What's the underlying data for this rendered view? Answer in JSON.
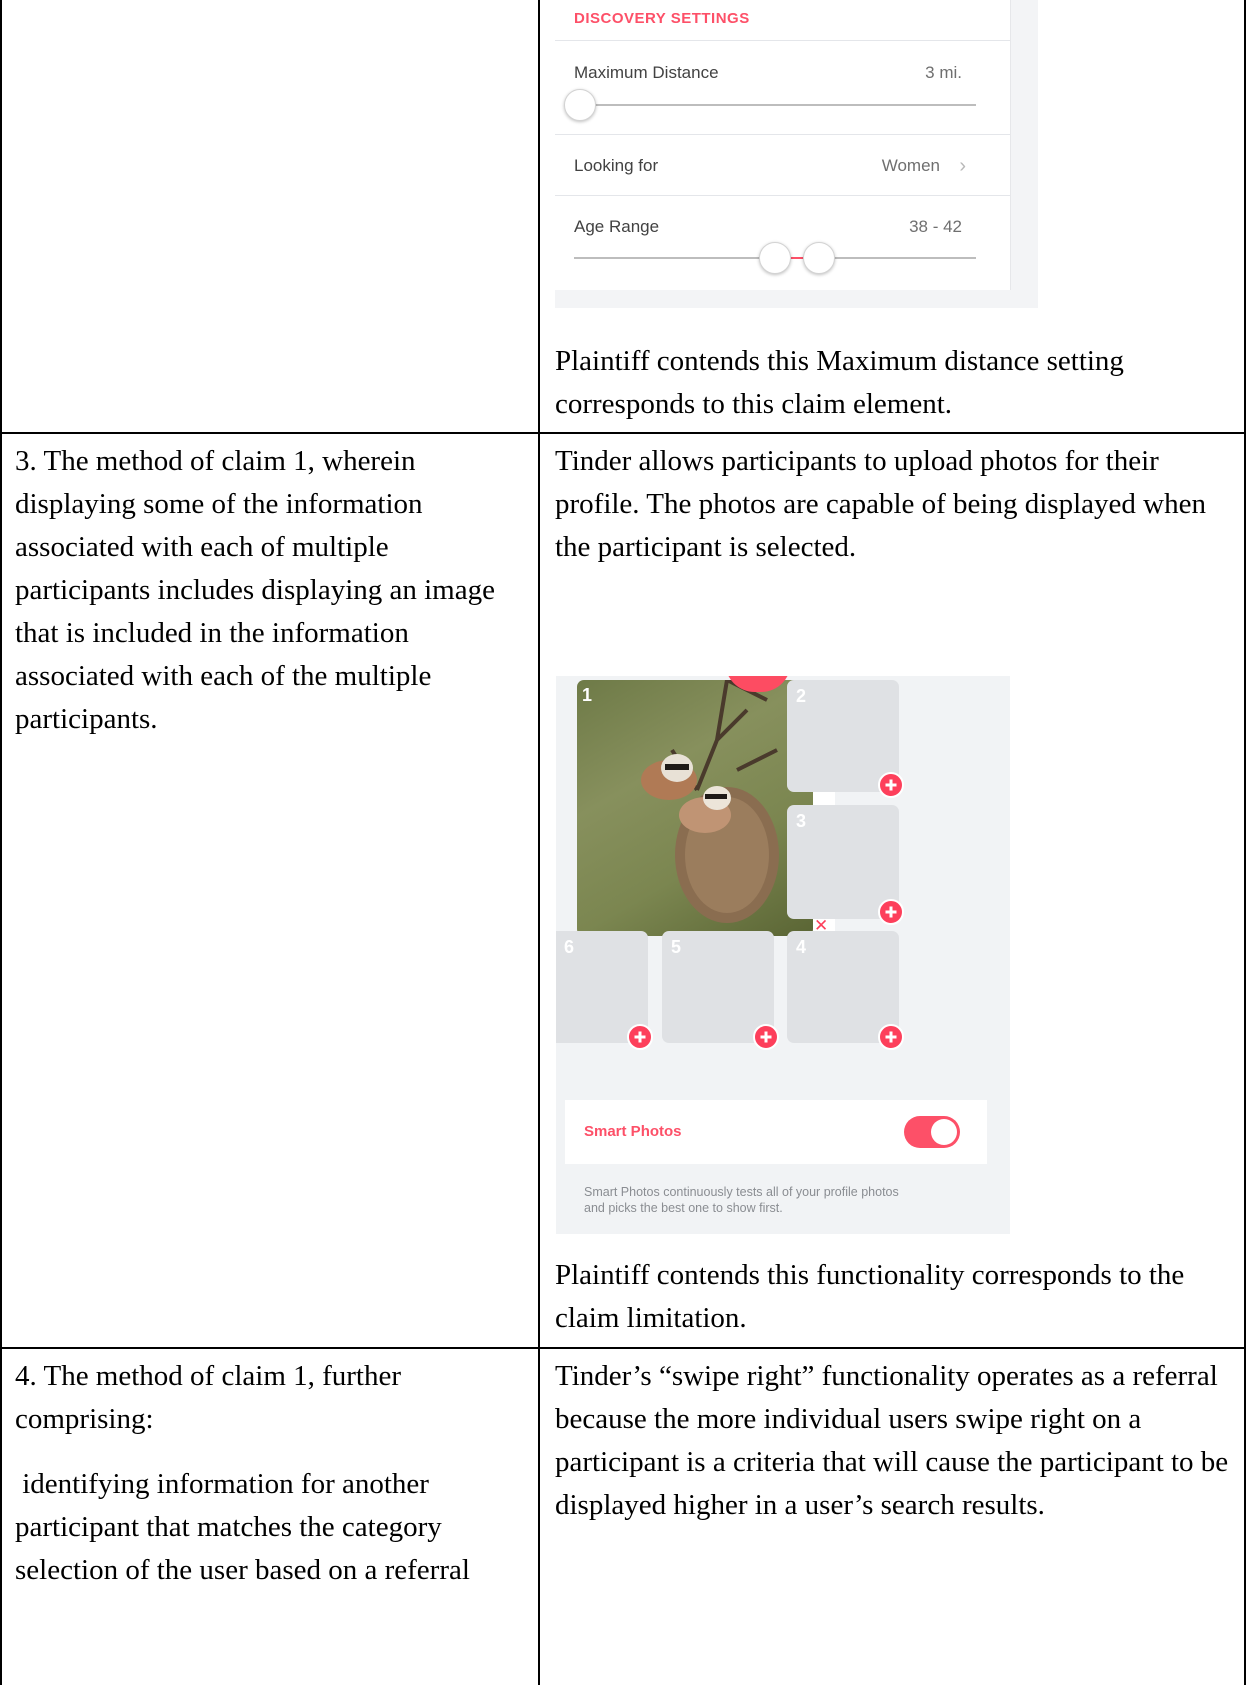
{
  "row1": {
    "discovery": {
      "heading": "DISCOVERY SETTINGS",
      "max_distance_label": "Maximum Distance",
      "max_distance_value": "3 mi.",
      "looking_for_label": "Looking for",
      "looking_for_value": "Women",
      "age_range_label": "Age Range",
      "age_range_value": "38 - 42"
    },
    "caption": "Plaintiff contends this Maximum distance setting corresponds to this claim element."
  },
  "row2": {
    "claim": "3.  The method of claim 1, wherein displaying some of the information associated with each of multiple participants includes displaying an image that is included in the information associated with each of the multiple participants.",
    "description": "Tinder allows participants to upload photos for their profile.  The photos are capable of being displayed when the participant is selected.",
    "photos": {
      "slot_numbers": [
        "1",
        "2",
        "3",
        "6",
        "5",
        "4"
      ],
      "smart_photos_label": "Smart Photos",
      "smart_photos_desc": "Smart Photos continuously tests all of your profile photos and picks the best one to show first."
    },
    "caption": "Plaintiff contends this functionality corresponds to the claim limitation."
  },
  "row3": {
    "claim_line1": "4.   The method of claim 1, further comprising:",
    "claim_line2": " identifying information for another participant that matches the category selection of the user based on a referral",
    "description": "Tinder’s “swipe right” functionality operates as a referral because the more individual users swipe right on a participant is a criteria that will cause the participant to be displayed higher in a user’s search results."
  }
}
